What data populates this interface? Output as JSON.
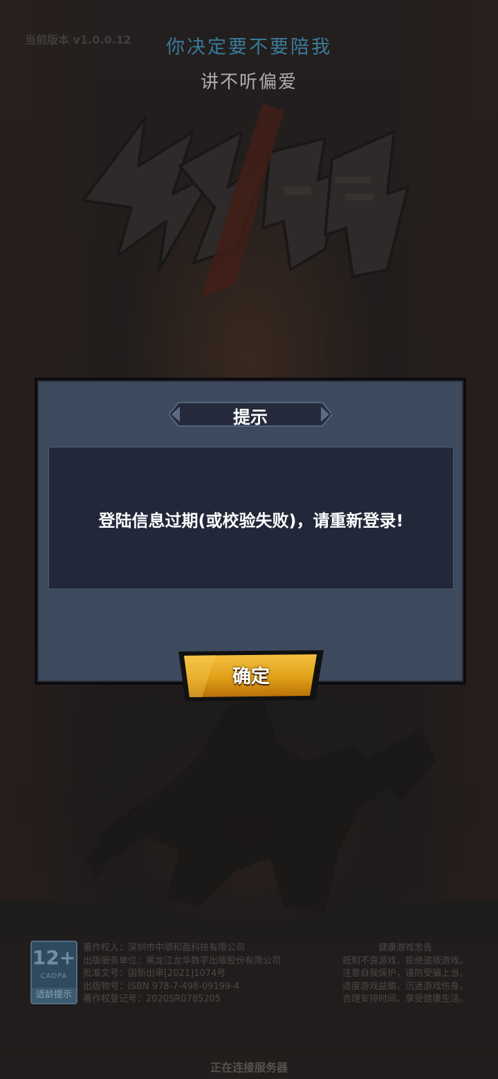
{
  "header": {
    "version": "当前版本 v1.0.0.12",
    "lyric_line_1": "你决定要不要陪我",
    "lyric_line_2": "讲不听偏爱",
    "logo_text": "火影觉醒"
  },
  "dialog": {
    "title": "提示",
    "message": "登陆信息过期(或校验失败)，请重新登录!",
    "confirm_label": "确定"
  },
  "footer": {
    "age_rating": "12+",
    "age_org": "CADPA",
    "age_tip": "适龄提示",
    "copyright_lines": [
      "著作权人：深圳市中顺和盈科技有限公司",
      "出版服务单位：黑龙江龙华数字出版股份有限公司",
      "批准文号：国新出审[2021]1074号",
      "出版物号：ISBN 978-7-498-09199-4",
      "著作权登记号：2020SR0785205"
    ],
    "health_lines": [
      "健康游戏忠告",
      "抵制不良游戏，拒绝盗版游戏。",
      "注意自我保护，谨防受骗上当。",
      "适度游戏益脑，沉迷游戏伤身。",
      "合理安排时间，享受健康生活。"
    ],
    "status": "正在连接服务器"
  },
  "colors": {
    "lyric_accent": "#4fb3e0",
    "dialog_panel": "#3d4a5e",
    "dialog_body": "#22283a",
    "button_gold": "#e0a018"
  }
}
